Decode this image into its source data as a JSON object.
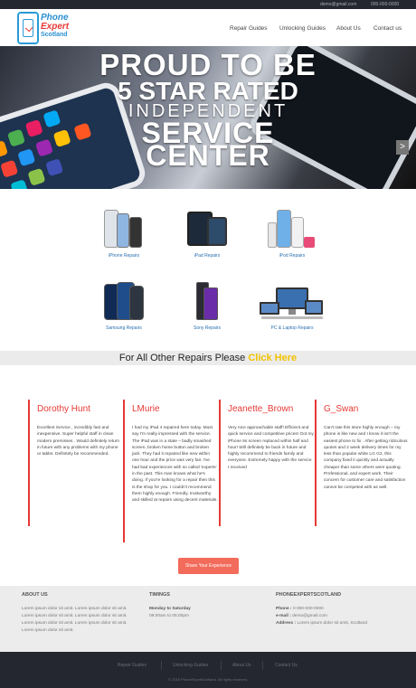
{
  "topbar": {
    "email": "demo@gmail.com",
    "phone": "000-000-0000"
  },
  "logo": {
    "line1": "Phone",
    "line2": "Expert",
    "line3": "Scotland"
  },
  "nav": {
    "items": [
      "Repair Guides",
      "Unlocking Guides",
      "About Us",
      "Contact us"
    ]
  },
  "hero": {
    "line1": "PROUD TO BE",
    "line2": "5 STAR RATED",
    "line3": "INDEPENDENT",
    "line4": "SERVICE",
    "line5": "CENTER",
    "next_arrow": ">"
  },
  "products": [
    {
      "label": "iPhone Repairs",
      "icon": "iphone-group-icon"
    },
    {
      "label": "iPad Repairs",
      "icon": "ipad-group-icon"
    },
    {
      "label": "iPod Repairs",
      "icon": "ipod-group-icon"
    },
    {
      "label": "Samsung Repairs",
      "icon": "samsung-phones-icon"
    },
    {
      "label": "Sony Repairs",
      "icon": "sony-phones-icon"
    },
    {
      "label": "PC & Laptop Repairs",
      "icon": "pc-laptop-icon"
    }
  ],
  "banner": {
    "text": "For All Other Repairs Please ",
    "link": "Click Here"
  },
  "testimonials": [
    {
      "name": "Dorothy Hunt",
      "text": "Excellent Service , incredibly fast and inexpensive. Super helpful staff in clean modern premisses . Would definitely return in future with any problems with my phone or tablet. Definitely be recommended."
    },
    {
      "name": "LMurie",
      "text": "I had my iPad 4 repaired here today. Must say I'm really impressed with the service. The iPad was in a state – badly smashed screen, broken home button and broken jack. They had it repaired like new within one hour and the price was very fair. I've had bad experiences with so called 'experts' in the past. This man knows what he's doing. If you're looking for a repair then this is the shop for you. I couldn't recommend them highly enough. Friendly, trustworthy and skilled at repairs using decent materials."
    },
    {
      "name": "Jeanette_Brown",
      "text": "Very nice approachable staff! Efficient and quick service and competitive prices! Got my iPhone 5s screen replaced within half and hour! Will definitely be back in future and highly recommend to friends family and everyone. Extremely happy with the service I received"
    },
    {
      "name": "G_Swan",
      "text": "Can't rate this store highly enough – my phone is like new and I know it isn't the easiest phone to fix . After getting ridiculous quotes and 2 week delivery times for my less than popular white LG G2, this company fixed it quickly and actually cheaper than some others were quoting. Professional, and expert work. Their concern for customer care and satisfaction cannot be competed with as well."
    }
  ],
  "share_button": "Share Your Experience",
  "footer": {
    "about_title": "ABOUT US",
    "about_text": "Lorem ipsum dolor sit amit. Lorem ipsum dolor sit amit. Lorem ipsum dolor sit amit. Lorem ipsum dolor sit amit. Lorem ipsum dolor sit amit. Lorem ipsum dolor sit amit. Lorem ipsum dolor sit amit.",
    "timings_title": "TIMINGS",
    "timings_days": "Monday to Saturday",
    "timings_hours": "09:00am to 05:00pm",
    "company_title": "PHONEEXPERTSCOTLAND",
    "phone_label": "Phone :",
    "phone_value": "0 000-000-0000",
    "email_label": "e-mail :",
    "email_value": "demo@gmail.com",
    "address_label": "Address :",
    "address_value": "Lorem ipsum dolor sit amit, Scotland"
  },
  "bottom": {
    "links": [
      "Repair Guides",
      "Unlocking Guides",
      "About Us",
      "Contact Us"
    ],
    "copyright": "© 2015 PhoneExpertScotland. All rights reserved."
  },
  "colors": {
    "accent": "#e53935",
    "brand_blue": "#2a9ad6",
    "highlight": "#f2c200",
    "button": "#f26b5b",
    "dark": "#24272f"
  }
}
